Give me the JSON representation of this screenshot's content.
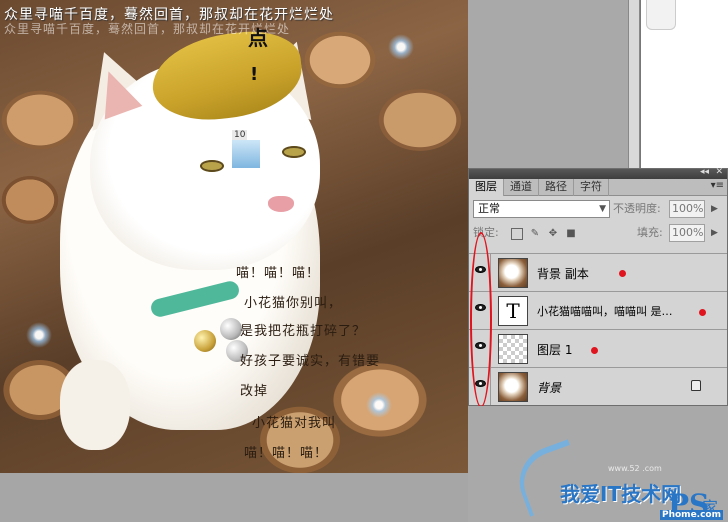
{
  "canvas": {
    "caption_line1": "众里寻喵千百度，蓦然回首，那叔却在花开烂烂处",
    "caption_line2": "众里寻喵千百度，蓦然回首，那叔却在花开烂烂处",
    "poem_lines": [
      "喵！喵！喵！",
      "小花猫你别叫，",
      "是我把花瓶打碎了？",
      "好孩子要诚实，有错要",
      "改掉",
      "小花猫对我叫",
      "喵！喵！喵！"
    ]
  },
  "document": {
    "text1": "点",
    "text2": "!",
    "page_number": "10"
  },
  "layers_panel": {
    "collapse_glyph": "◂◂",
    "close_glyph": "✕",
    "menu_glyph": "▾≡",
    "tabs": [
      "图层",
      "通道",
      "路径",
      "字符"
    ],
    "active_tab": "图层",
    "blend_mode": "正常",
    "opacity_label": "不透明度:",
    "opacity_value": "100%",
    "lock_label": "锁定:",
    "fill_label": "填充:",
    "fill_value": "100%",
    "layers": [
      {
        "name": "背景 副本",
        "thumbnail": "cat-photo",
        "visible": true
      },
      {
        "name": "小花猫喵喵叫，喵喵叫  是…",
        "thumbnail": "text-T",
        "visible": true
      },
      {
        "name": "图层 1",
        "thumbnail": "transparent-cat",
        "visible": true
      },
      {
        "name": "背景",
        "thumbnail": "cat-photo",
        "visible": true,
        "locked": true
      }
    ],
    "annotation_color": "#e0141e"
  },
  "watermark": {
    "site": "www.52 .com",
    "text": "我爱IT技术网",
    "ps_logo": "PS",
    "jia": "家",
    "url": "Phome.com"
  }
}
